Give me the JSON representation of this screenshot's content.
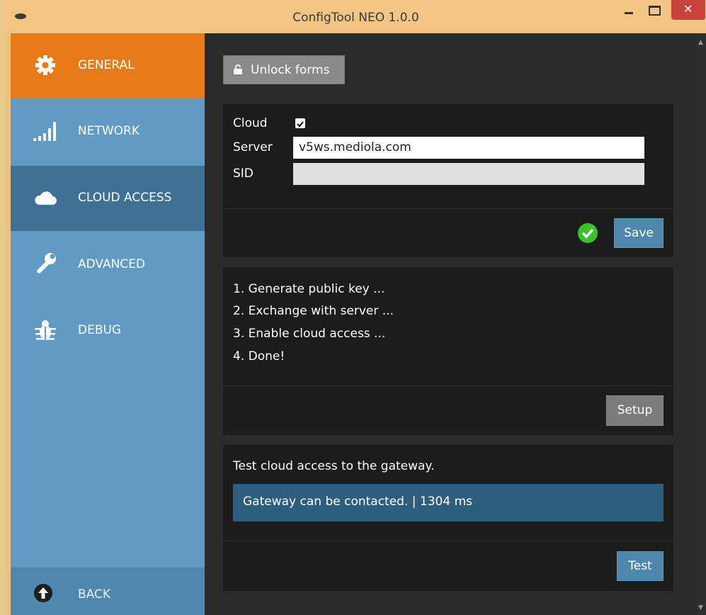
{
  "window": {
    "title": "ConfigTool NEO 1.0.0",
    "controls": [
      "minimize",
      "maximize",
      "close"
    ],
    "accent": "#e87a1a",
    "sidebar_color": "#5f9bc2",
    "sidebar_active_color": "#3f7194",
    "close_color": "#c7433b"
  },
  "sidebar": {
    "items": [
      {
        "label": "GENERAL",
        "icon": "gear-icon"
      },
      {
        "label": "NETWORK",
        "icon": "signal-bars-icon"
      },
      {
        "label": "CLOUD ACCESS",
        "icon": "cloud-icon"
      },
      {
        "label": "ADVANCED",
        "icon": "wrench-icon"
      },
      {
        "label": "DEBUG",
        "icon": "bug-icon"
      }
    ],
    "back": {
      "label": "BACK",
      "icon": "arrow-up-circle-icon"
    }
  },
  "main": {
    "unlock_button": {
      "label": "Unlock forms",
      "icon": "lock-icon"
    },
    "cloud_form": {
      "cloud_label": "Cloud",
      "cloud_checked": true,
      "server_label": "Server",
      "server_value": "v5ws.mediola.com",
      "sid_label": "SID",
      "sid_value": "",
      "status_icon": "check-circle-icon",
      "save_label": "Save"
    },
    "setup": {
      "steps": [
        "1. Generate public key ...",
        "2. Exchange with server ...",
        "3. Enable cloud access ...",
        "4. Done!"
      ],
      "setup_label": "Setup"
    },
    "test": {
      "description": "Test cloud access to the gateway.",
      "result": "Gateway can be contacted. | 1304 ms",
      "test_label": "Test"
    }
  }
}
